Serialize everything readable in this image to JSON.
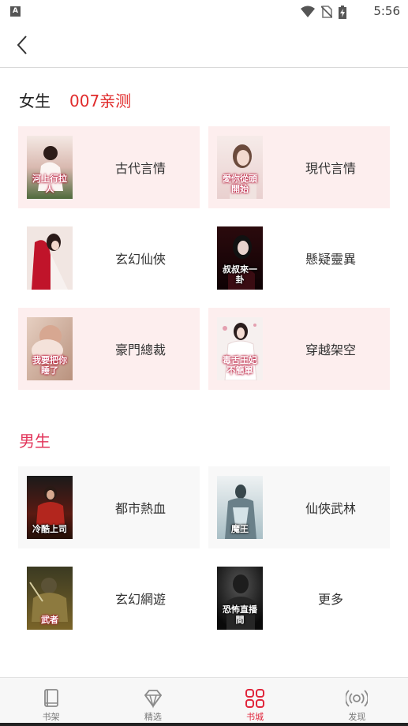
{
  "status_bar": {
    "time": "5:56",
    "left_icon_letter": "A"
  },
  "female_section": {
    "title": "女生",
    "tag": "007亲测",
    "items": [
      {
        "label": "古代言情",
        "cover_text": "河上行拉人"
      },
      {
        "label": "現代言情",
        "cover_text": "愛你從頭開始"
      },
      {
        "label": "玄幻仙俠",
        "cover_text": ""
      },
      {
        "label": "懸疑靈異",
        "cover_text": "叔叔來一卦"
      },
      {
        "label": "豪門總裁",
        "cover_text": "我要把你睡了"
      },
      {
        "label": "穿越架空",
        "cover_text": "毒舌王妃不簡單"
      }
    ]
  },
  "male_section": {
    "title": "男生",
    "items": [
      {
        "label": "都市熱血",
        "cover_text": "冷酷上司"
      },
      {
        "label": "仙俠武林",
        "cover_text": "魔王"
      },
      {
        "label": "玄幻網遊",
        "cover_text": "武者"
      },
      {
        "label": "更多",
        "cover_text": "恐怖直播間"
      }
    ]
  },
  "tabs": [
    {
      "label": "书架",
      "icon": "book-icon",
      "active": false
    },
    {
      "label": "精选",
      "icon": "diamond-icon",
      "active": false
    },
    {
      "label": "书城",
      "icon": "grid-icon",
      "active": true
    },
    {
      "label": "发现",
      "icon": "radio-signal-icon",
      "active": false
    }
  ],
  "colors": {
    "accent_red": "#e02b2b",
    "male_title": "#e2345a",
    "pink_card": "#fdeeee",
    "gray_card": "#f8f8f8",
    "tab_active": "#e0263c"
  }
}
